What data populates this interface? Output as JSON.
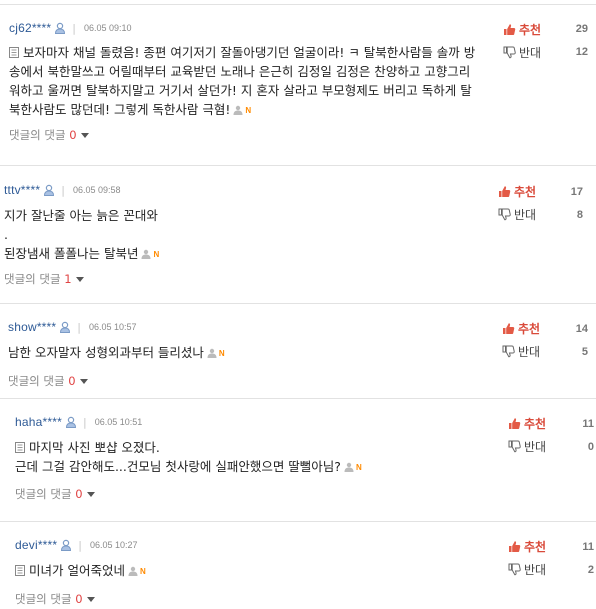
{
  "labels": {
    "like": "추천",
    "dislike": "반대",
    "replies": "댓글의 댓글"
  },
  "comments": [
    {
      "user": "cj62****",
      "time": "06.05 09:10",
      "lines": [
        "보자마자 채널 돌렸음! 종편 여기저기 잘돌아댕기던 얼굴이라! ㅋ 탈북한사람들 솔까 방",
        "송에서 북한말쓰고 어릴때부터 교육받던 노래나 은근히 김정일 김정은 찬양하고 고향그리",
        "워하고 울꺼면 탈북하지말고 거기서 살던가! 지 혼자 살라고 부모형제도 버리고 독하게 탈",
        "북한사람도 많던데! 그렇게 독한사람 극혐!"
      ],
      "likes": "29",
      "dislikes": "12",
      "reply_count": "0"
    },
    {
      "user": "tttv****",
      "time": "06.05 09:58",
      "lines": [
        "지가 잘난줄 아는 늙은 꼰대와",
        ".",
        "된장냄새 폴폴나는 탈북년"
      ],
      "likes": "17",
      "dislikes": "8",
      "reply_count": "1"
    },
    {
      "user": "show****",
      "time": "06.05 10:57",
      "lines": [
        "남한 오자말자 성형외과부터 들리셨나"
      ],
      "likes": "14",
      "dislikes": "5",
      "reply_count": "0"
    },
    {
      "user": "haha****",
      "time": "06.05 10:51",
      "lines": [
        "마지막 사진 뽀샵 오졌다.",
        "근데 그걸 감안해도...건모님 첫사랑에 실패안했으면 딸뻘아님?"
      ],
      "likes": "11",
      "dislikes": "0",
      "reply_count": "0"
    },
    {
      "user": "devi****",
      "time": "06.05 10:27",
      "lines": [
        "미녀가 얼어죽었네"
      ],
      "likes": "11",
      "dislikes": "2",
      "reply_count": "0"
    }
  ],
  "icons": {
    "user": "person-icon",
    "doc": "document-icon",
    "profile_badge": "user-badge-icon",
    "new_badge": "N",
    "like": "thumbs-up-icon",
    "dislike": "thumbs-down-icon",
    "expand": "caret-down-icon"
  },
  "colors": {
    "username": "#2e5a96",
    "like": "#d94a3a",
    "reply_count": "#e04444",
    "new_badge": "#ff8a00",
    "divider": "#e2e2e2"
  }
}
